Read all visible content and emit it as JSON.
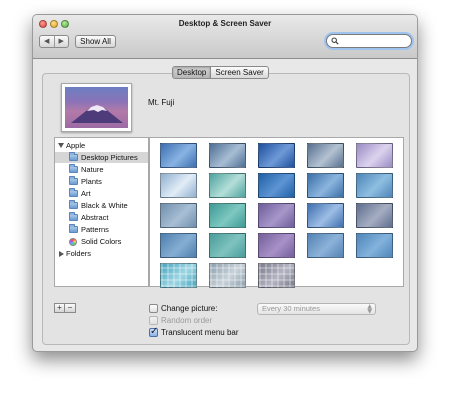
{
  "window": {
    "title": "Desktop & Screen Saver"
  },
  "toolbar": {
    "back_label": "◀",
    "forward_label": "▶",
    "show_all_label": "Show All",
    "search_placeholder": ""
  },
  "tabs": [
    {
      "label": "Desktop",
      "selected": true
    },
    {
      "label": "Screen Saver",
      "selected": false
    }
  ],
  "current_picture": {
    "name": "Mt. Fuji"
  },
  "sources": {
    "group_apple": "Apple",
    "items": [
      {
        "label": "Desktop Pictures",
        "icon": "folder-icon",
        "selected": true
      },
      {
        "label": "Nature",
        "icon": "folder-icon"
      },
      {
        "label": "Plants",
        "icon": "folder-icon"
      },
      {
        "label": "Art",
        "icon": "folder-icon"
      },
      {
        "label": "Black & White",
        "icon": "folder-icon"
      },
      {
        "label": "Abstract",
        "icon": "folder-icon"
      },
      {
        "label": "Patterns",
        "icon": "folder-icon"
      },
      {
        "label": "Solid Colors",
        "icon": "color-wheel-icon"
      }
    ],
    "group_folders": "Folders"
  },
  "thumbnails": [
    {
      "colors": [
        "#3d6fb0",
        "#88b3e3"
      ]
    },
    {
      "colors": [
        "#4f6f94",
        "#a7bdd4"
      ]
    },
    {
      "colors": [
        "#1e4f9e",
        "#6f9ad8"
      ]
    },
    {
      "colors": [
        "#56708f",
        "#b4c2d2"
      ]
    },
    {
      "colors": [
        "#9a8cc4",
        "#dcd3ee"
      ]
    },
    {
      "colors": [
        "#8fb0cf",
        "#e2edf7"
      ]
    },
    {
      "colors": [
        "#4fa3a0",
        "#b4dfd8"
      ]
    },
    {
      "colors": [
        "#1f5fa6",
        "#5e95d4"
      ]
    },
    {
      "colors": [
        "#3b6fa8",
        "#8bb5de"
      ]
    },
    {
      "colors": [
        "#4e86b8",
        "#8ebfe1"
      ]
    },
    {
      "colors": [
        "#6f8fae",
        "#a9bfd4"
      ]
    },
    {
      "colors": [
        "#3f9a96",
        "#7ec8c0"
      ]
    },
    {
      "colors": [
        "#6f5c9c",
        "#a797c9"
      ]
    },
    {
      "colors": [
        "#3e6fae",
        "#9dbde6"
      ]
    },
    {
      "colors": [
        "#5f6f8f",
        "#a5adc2"
      ]
    },
    {
      "colors": [
        "#4e7fae",
        "#86aed3"
      ]
    },
    {
      "colors": [
        "#4a9c9a",
        "#7fc3bf"
      ]
    },
    {
      "colors": [
        "#745f9c",
        "#a891c7"
      ]
    },
    {
      "colors": [
        "#5483b5",
        "#8cb2d8"
      ]
    },
    {
      "colors": [
        "#4f86b9",
        "#83b2dc"
      ]
    },
    {
      "colors": [
        "#48a6bf",
        "#9fd6e3"
      ]
    },
    {
      "colors": [
        "#8ea0ad",
        "#c8d2d9"
      ]
    },
    {
      "colors": [
        "#7a7c8c",
        "#b4b5c2"
      ]
    }
  ],
  "options": {
    "change_picture_label": "Change picture:",
    "change_picture_checked": false,
    "interval_value": "Every 30 minutes",
    "random_order_label": "Random order",
    "random_order_checked": false,
    "translucent_label": "Translucent menu bar",
    "translucent_checked": true
  },
  "buttons": {
    "add_label": "+",
    "remove_label": "−",
    "help_label": "?"
  }
}
